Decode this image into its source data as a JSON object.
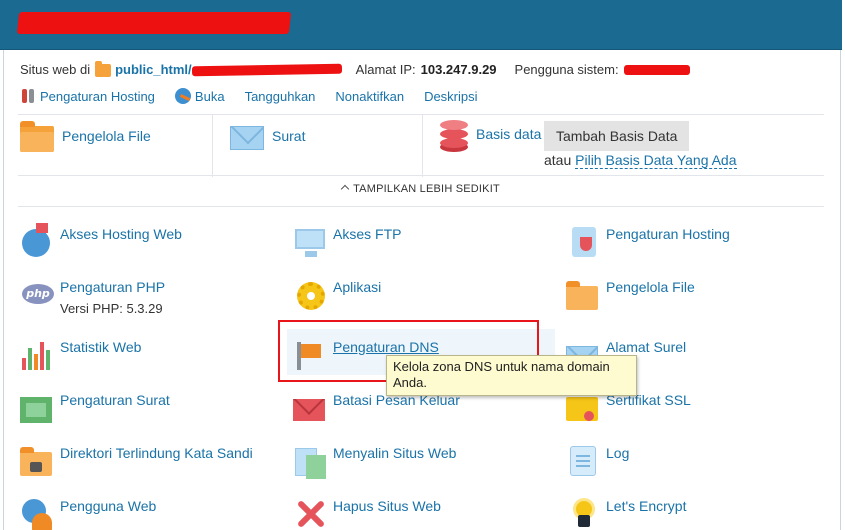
{
  "header": {
    "title_redacted": true
  },
  "site_info": {
    "website_label": "Situs web di",
    "path_prefix": "public_html/",
    "ip_label": "Alamat IP:",
    "ip_value": "103.247.9.29",
    "system_user_label": "Pengguna sistem:"
  },
  "actions": [
    {
      "label": "Pengaturan Hosting",
      "icon": "wrench-icon"
    },
    {
      "label": "Buka",
      "icon": "globe-icon"
    },
    {
      "label": "Tangguhkan"
    },
    {
      "label": "Nonaktifkan"
    },
    {
      "label": "Deskripsi"
    }
  ],
  "top_tiles": {
    "file_manager": "Pengelola File",
    "mail": "Surat",
    "databases": "Basis data",
    "add_database_button": "Tambah Basis Data",
    "or_text": "atau",
    "choose_existing_link": "Pilih Basis Data Yang Ada"
  },
  "show_less": "TAMPILKAN LEBIH SEDIKIT",
  "grid": [
    {
      "label": "Akses Hosting Web",
      "icon": "globe-flag-icon"
    },
    {
      "label": "Akses FTP",
      "icon": "ftp-monitor-icon"
    },
    {
      "label": "Pengaturan Hosting",
      "icon": "hosting-shield-icon"
    },
    {
      "label": "Pengaturan PHP",
      "sub": "Versi PHP: 5.3.29",
      "icon": "php-icon"
    },
    {
      "label": "Aplikasi",
      "icon": "gear-icon"
    },
    {
      "label": "Pengelola File",
      "icon": "folder-icon"
    },
    {
      "label": "Statistik Web",
      "icon": "bar-chart-icon"
    },
    {
      "label": "Pengaturan DNS",
      "icon": "dns-flag-icon"
    },
    {
      "label": "Alamat Surel",
      "icon": "envelope-icon"
    },
    {
      "label": "Pengaturan Surat",
      "icon": "mail-settings-icon"
    },
    {
      "label": "Batasi Pesan Keluar",
      "icon": "outgoing-mail-icon"
    },
    {
      "label": "Sertifikat SSL",
      "icon": "certificate-icon"
    },
    {
      "label": "Direktori Terlindung Kata Sandi",
      "icon": "locked-folder-icon"
    },
    {
      "label": "Menyalin Situs Web",
      "icon": "copy-site-icon"
    },
    {
      "label": "Log",
      "icon": "log-icon"
    },
    {
      "label": "Pengguna Web",
      "icon": "web-user-icon"
    },
    {
      "label": "Hapus Situs Web",
      "icon": "delete-x-icon"
    },
    {
      "label": "Let's Encrypt",
      "icon": "lets-encrypt-icon"
    }
  ],
  "tooltip": "Kelola zona DNS untuk nama domain Anda.",
  "colors": {
    "header": "#1a6a92",
    "link": "#1a73a8",
    "redaction": "#ee1111",
    "highlight": "#e8161b",
    "tooltip_bg": "#fdfbcf"
  }
}
